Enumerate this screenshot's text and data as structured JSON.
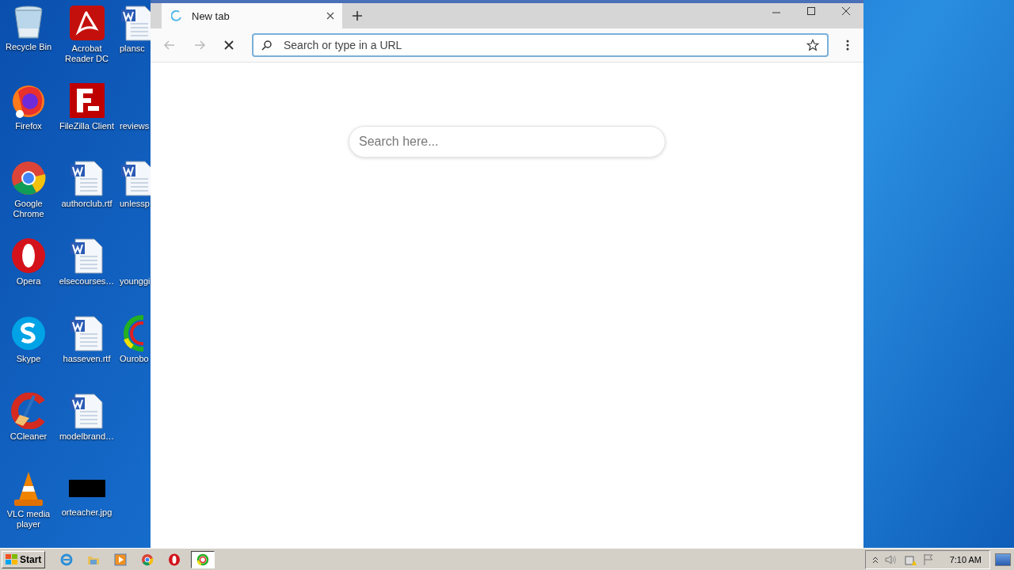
{
  "desktop_icons": [
    {
      "label": "Recycle Bin",
      "kind": "recycle"
    },
    {
      "label": "Firefox",
      "kind": "firefox"
    },
    {
      "label": "Google Chrome",
      "kind": "chrome"
    },
    {
      "label": "Opera",
      "kind": "opera"
    },
    {
      "label": "Skype",
      "kind": "skype"
    },
    {
      "label": "CCleaner",
      "kind": "ccleaner"
    },
    {
      "label": "VLC media player",
      "kind": "vlc"
    },
    {
      "label": "Acrobat Reader DC",
      "kind": "pdf"
    },
    {
      "label": "FileZilla Client",
      "kind": "filezilla"
    },
    {
      "label": "authorclub.rtf",
      "kind": "word"
    },
    {
      "label": "elsecourses…",
      "kind": "word"
    },
    {
      "label": "hasseven.rtf",
      "kind": "word"
    },
    {
      "label": "modelbrand…",
      "kind": "word"
    },
    {
      "label": "orteacher.jpg",
      "kind": "image"
    },
    {
      "label": "plansc",
      "kind": "word"
    },
    {
      "label": "reviews",
      "kind": "blank"
    },
    {
      "label": "unlessp",
      "kind": "word"
    },
    {
      "label": "younggi",
      "kind": "blank"
    },
    {
      "label": "Ourobo",
      "kind": "ouroboros"
    }
  ],
  "browser": {
    "tabs": [
      {
        "label": "New tab",
        "selected": true,
        "loading": true
      }
    ],
    "address_bar": {
      "placeholder": "Search or type in a URL"
    },
    "page": {
      "search": {
        "placeholder": "Search here..."
      }
    }
  },
  "taskbar": {
    "start": "Start",
    "apps": [
      {
        "kind": "ie",
        "selected": false
      },
      {
        "kind": "folder",
        "selected": false
      },
      {
        "kind": "media",
        "selected": false
      },
      {
        "kind": "chrome",
        "selected": false
      },
      {
        "kind": "opera",
        "selected": false
      },
      {
        "kind": "ouroboros",
        "selected": true
      }
    ],
    "clock": "7:10 AM"
  }
}
